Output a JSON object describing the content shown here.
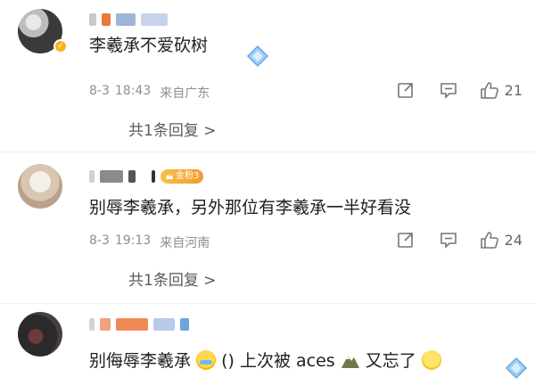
{
  "comments": [
    {
      "text": "李羲承不爱砍树",
      "date": "8-3",
      "time": "18:43",
      "location": "来自广东",
      "likes": "21",
      "replies_label": "共1条回复",
      "reply_chevron": ">",
      "verified": true
    },
    {
      "text": "别辱李羲承，另外那位有李羲承一半好看没",
      "date": "8-3",
      "time": "19:13",
      "location": "来自河南",
      "likes": "24",
      "replies_label": "共1条回复",
      "reply_chevron": ">",
      "badge_label": "金粉3"
    },
    {
      "text_part1": "别侮辱李羲承",
      "text_part2": "() 上次被 aces",
      "text_part3": "又忘了"
    }
  ],
  "icons": {
    "share": "share-icon",
    "comment": "comment-icon",
    "like": "thumbs-up-icon",
    "diamond": "diamond-badge-icon",
    "crown": "crown-icon"
  },
  "colors": {
    "meta_text": "#8e8e8e",
    "badge": "#f29a2b",
    "verified": "#f5b31f"
  }
}
